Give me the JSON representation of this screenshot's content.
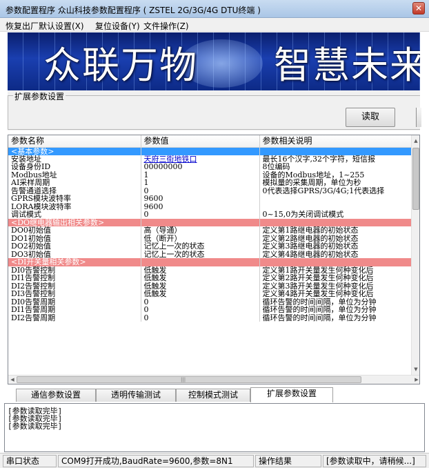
{
  "window": {
    "title": "参数配置程序 众山科技参数配置程序 ( ZSTEL 2G/3G/4G DTU终端 )"
  },
  "menu": [
    "恢复出厂默认设置(X)",
    "复位设备(Y)",
    "文件操作(Z)"
  ],
  "banner": {
    "left": "众联万物",
    "right": "智慧未来"
  },
  "ext_group": {
    "legend": "扩展参数设置",
    "read_button": "读取"
  },
  "grid": {
    "headers": [
      "参数名称",
      "参数值",
      "参数相关说明"
    ],
    "rows": [
      {
        "type": "sect-blue",
        "name": "<基本参数>",
        "value": "",
        "desc": ""
      },
      {
        "type": "row",
        "name": "安装地址",
        "value": "天府三街地铁口",
        "desc": "最长16个汉字,32个字符，短信报",
        "link": true
      },
      {
        "type": "row",
        "name": "设备身份ID",
        "value": "00000000",
        "desc": "8位编码"
      },
      {
        "type": "row",
        "name": "Modbus地址",
        "value": "1",
        "desc": "设备的Modbus地址，1~255"
      },
      {
        "type": "row",
        "name": "AI采样周期",
        "value": "1",
        "desc": "模拟量的采集周期，单位为秒"
      },
      {
        "type": "row",
        "name": "告警通道选择",
        "value": "0",
        "desc": "0代表选择GPRS/3G/4G;1代表选择"
      },
      {
        "type": "row",
        "name": "GPRS模块波特率",
        "value": "9600",
        "desc": ""
      },
      {
        "type": "row",
        "name": "LORA模块波特率",
        "value": "9600",
        "desc": ""
      },
      {
        "type": "row",
        "name": "调试模式",
        "value": "0",
        "desc": "0~15,0为关闭调试模式"
      },
      {
        "type": "sect-pink",
        "name": "<DO继电器输出相关参数>",
        "value": "",
        "desc": ""
      },
      {
        "type": "row",
        "name": "DO0初始值",
        "value": "高（导通）",
        "desc": "定义第1路继电器的初始状态"
      },
      {
        "type": "row",
        "name": "DO1初始值",
        "value": "低（断开）",
        "desc": "定义第2路继电器的初始状态"
      },
      {
        "type": "row",
        "name": "DO2初始值",
        "value": "记忆上一次的状态",
        "desc": "定义第3路继电器的初始状态"
      },
      {
        "type": "row",
        "name": "DO3初始值",
        "value": "记忆上一次的状态",
        "desc": "定义第4路继电器的初始状态"
      },
      {
        "type": "sect-pink",
        "name": "<DI开关量相关参数>",
        "value": "",
        "desc": ""
      },
      {
        "type": "row",
        "name": "DI0告警控制",
        "value": "低触发",
        "desc": "定义第1路开关量发生何种变化后"
      },
      {
        "type": "row",
        "name": "DI1告警控制",
        "value": "低触发",
        "desc": "定义第2路开关量发生何种变化后"
      },
      {
        "type": "row",
        "name": "DI2告警控制",
        "value": "低触发",
        "desc": "定义第3路开关量发生何种变化后"
      },
      {
        "type": "row",
        "name": "DI3告警控制",
        "value": "低触发",
        "desc": "定义第4路开关量发生何种变化后"
      },
      {
        "type": "row",
        "name": "DI0告警周期",
        "value": "0",
        "desc": "循环告警的时间间隔，单位为分钟"
      },
      {
        "type": "row",
        "name": "DI1告警周期",
        "value": "0",
        "desc": "循环告警的时间间隔，单位为分钟"
      },
      {
        "type": "row",
        "name": "DI2告警周期",
        "value": "0",
        "desc": "循环告警的时间间隔，单位为分钟"
      }
    ]
  },
  "tabs": [
    "通信参数设置",
    "透明传输测试",
    "控制模式测试",
    "扩展参数设置"
  ],
  "log_lines": [
    "[参数读取完毕]",
    "[参数读取完毕]",
    "[参数读取完毕]"
  ],
  "status": {
    "label1": "串口状态",
    "port": "COM9打开成功,BaudRate=9600,参数=8N1",
    "label2": "操作结果",
    "result": "[参数读取中，请稍候...]"
  },
  "icons": {
    "close": "close-icon",
    "scroll_up": "arrow-up-icon",
    "scroll_down": "arrow-down-icon",
    "scroll_left": "arrow-left-icon",
    "scroll_right": "arrow-right-icon"
  }
}
